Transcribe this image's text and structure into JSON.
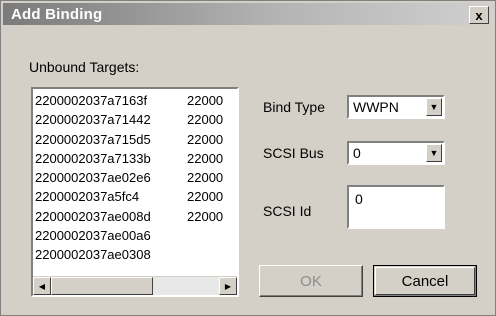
{
  "window": {
    "title": "Add Binding",
    "close_glyph": "x"
  },
  "unbound_targets": {
    "label": "Unbound Targets:",
    "column1": [
      "2200002037a7163f",
      "2200002037a71442",
      "2200002037a715d5",
      "2200002037a7133b",
      "2200002037ae02e6",
      "2200002037a5fc4",
      "2200002037ae008d",
      "2200002037ae00a6",
      "2200002037ae0308"
    ],
    "column2": [
      "22000",
      "22000",
      "22000",
      "22000",
      "22000",
      "22000",
      "22000"
    ],
    "scroll_left_glyph": "◀",
    "scroll_right_glyph": "▶"
  },
  "bind_type": {
    "label": "Bind Type",
    "value": "WWPN",
    "arrow": "▼"
  },
  "scsi_bus": {
    "label": "SCSI Bus",
    "value": "0",
    "arrow": "▼"
  },
  "scsi_id": {
    "label": "SCSI Id",
    "value": "0"
  },
  "buttons": {
    "ok": "OK",
    "cancel": "Cancel"
  },
  "icons": {
    "close": "close-icon",
    "dropdown": "chevron-down-icon",
    "scroll_left": "arrow-left-icon",
    "scroll_right": "arrow-right-icon"
  }
}
